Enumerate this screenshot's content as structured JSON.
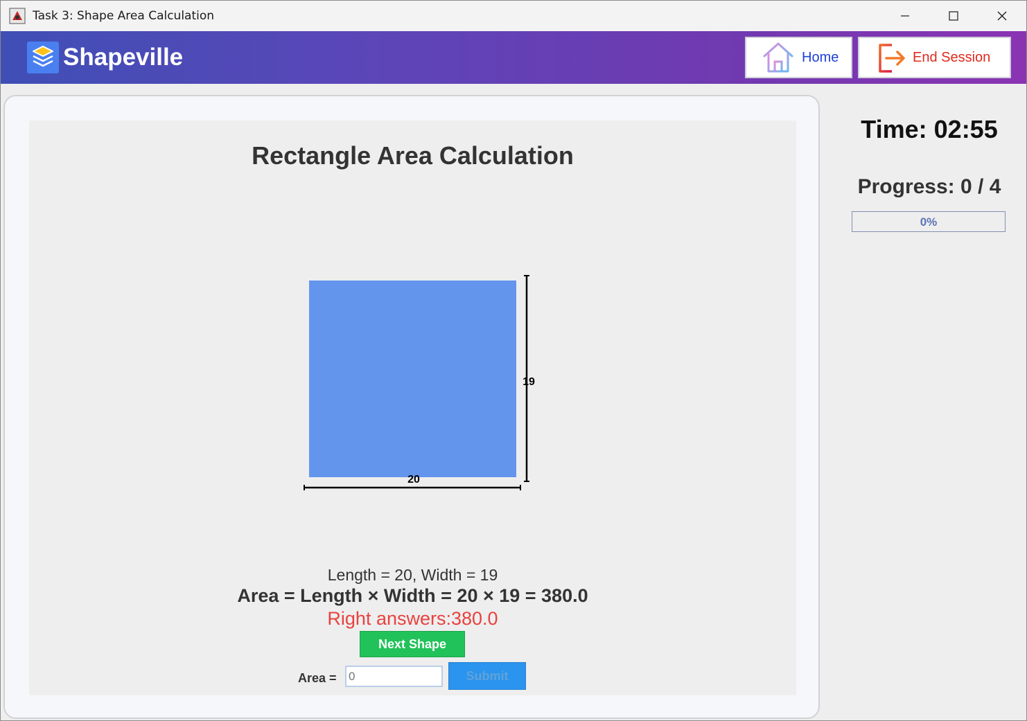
{
  "window": {
    "title": "Task 3: Shape Area Calculation"
  },
  "header": {
    "brand": "Shapeville",
    "home_label": "Home",
    "end_session_label": "End Session",
    "colors": {
      "gradient_start": "#3f4fb5",
      "gradient_end": "#8a34b2",
      "home_text": "#1f3fd6",
      "end_text": "#e02a1e"
    }
  },
  "task": {
    "title": "Rectangle Area Calculation",
    "shape": {
      "type": "rectangle",
      "fill": "#6495ed",
      "length": 20,
      "width": 19,
      "length_label": "20",
      "width_label": "19"
    },
    "given_text": "Length = 20, Width = 19",
    "formula_text": "Area = Length × Width = 20 × 19 = 380.0",
    "right_answer_text": "Right answers:380.0",
    "next_button_label": "Next Shape",
    "area_label": "Area =",
    "area_input_placeholder": "0",
    "area_input_value": "",
    "submit_label": "Submit"
  },
  "side": {
    "timer_text": "Time: 02:55",
    "progress_text": "Progress: 0 / 4",
    "progress_value": 0,
    "progress_pct_text": "0%"
  }
}
